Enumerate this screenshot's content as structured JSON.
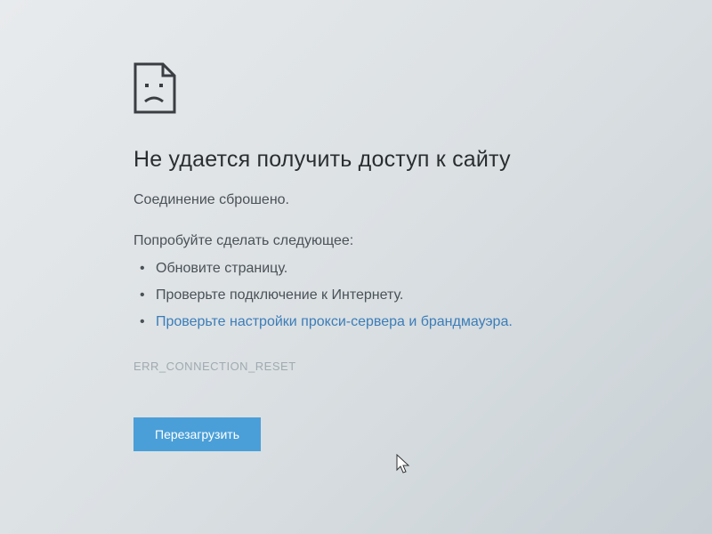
{
  "error": {
    "title": "Не удается получить доступ к сайту",
    "subtitle": "Соединение сброшено.",
    "suggestions_label": "Попробуйте сделать следующее:",
    "suggestions": [
      "Обновите страницу.",
      "Проверьте подключение к Интернету.",
      "Проверьте настройки прокси-сервера и брандмауэра."
    ],
    "error_code": "ERR_CONNECTION_RESET",
    "reload_button": "Перезагрузить"
  }
}
